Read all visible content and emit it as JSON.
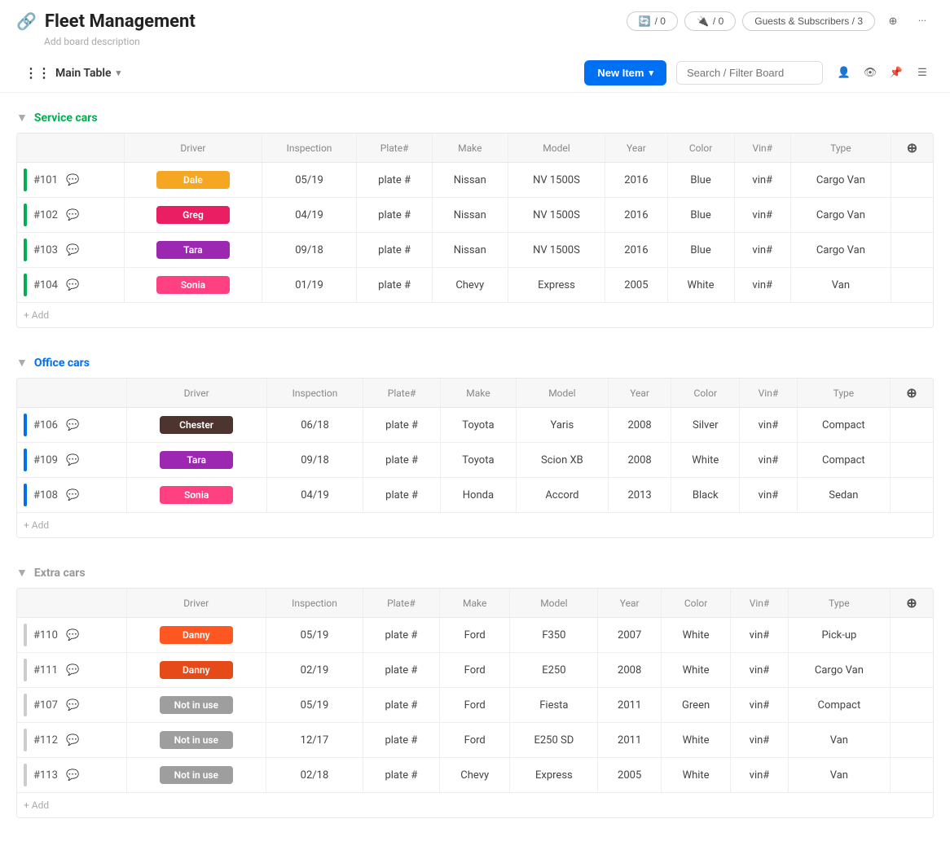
{
  "app": {
    "title": "Fleet Management",
    "subtitle": "Add board description"
  },
  "topbar": {
    "automations_count": "/ 0",
    "integrations_count": "/ 0",
    "guests_label": "Guests & Subscribers / 3",
    "more_icon": "···"
  },
  "toolbar": {
    "main_table_label": "Main Table",
    "new_item_label": "New Item",
    "search_placeholder": "Search / Filter Board"
  },
  "groups": [
    {
      "id": "service",
      "title": "Service cars",
      "color_class": "green",
      "bar_class": "green",
      "columns": [
        "Driver",
        "Inspection",
        "Plate#",
        "Make",
        "Model",
        "Year",
        "Color",
        "Vin#",
        "Type"
      ],
      "rows": [
        {
          "id": "#101",
          "driver": "Dale",
          "driver_color": "#f5a623",
          "inspection": "05/19",
          "plate": "plate #",
          "make": "Nissan",
          "model": "NV 1500S",
          "year": "2016",
          "color": "Blue",
          "vin": "vin#",
          "type": "Cargo Van"
        },
        {
          "id": "#102",
          "driver": "Greg",
          "driver_color": "#e91e63",
          "inspection": "04/19",
          "plate": "plate #",
          "make": "Nissan",
          "model": "NV 1500S",
          "year": "2016",
          "color": "Blue",
          "vin": "vin#",
          "type": "Cargo Van"
        },
        {
          "id": "#103",
          "driver": "Tara",
          "driver_color": "#9c27b0",
          "inspection": "09/18",
          "plate": "plate #",
          "make": "Nissan",
          "model": "NV 1500S",
          "year": "2016",
          "color": "Blue",
          "vin": "vin#",
          "type": "Cargo Van"
        },
        {
          "id": "#104",
          "driver": "Sonia",
          "driver_color": "#ff4081",
          "inspection": "01/19",
          "plate": "plate #",
          "make": "Chevy",
          "model": "Express",
          "year": "2005",
          "color": "White",
          "vin": "vin#",
          "type": "Van"
        }
      ]
    },
    {
      "id": "office",
      "title": "Office cars",
      "color_class": "blue",
      "bar_class": "blue",
      "columns": [
        "Driver",
        "Inspection",
        "Plate#",
        "Make",
        "Model",
        "Year",
        "Color",
        "Vin#",
        "Type"
      ],
      "rows": [
        {
          "id": "#106",
          "driver": "Chester",
          "driver_color": "#4e342e",
          "inspection": "06/18",
          "plate": "plate #",
          "make": "Toyota",
          "model": "Yaris",
          "year": "2008",
          "color": "Silver",
          "vin": "vin#",
          "type": "Compact"
        },
        {
          "id": "#109",
          "driver": "Tara",
          "driver_color": "#9c27b0",
          "inspection": "09/18",
          "plate": "plate #",
          "make": "Toyota",
          "model": "Scion XB",
          "year": "2008",
          "color": "White",
          "vin": "vin#",
          "type": "Compact"
        },
        {
          "id": "#108",
          "driver": "Sonia",
          "driver_color": "#ff4081",
          "inspection": "04/19",
          "plate": "plate #",
          "make": "Honda",
          "model": "Accord",
          "year": "2013",
          "color": "Black",
          "vin": "vin#",
          "type": "Sedan"
        }
      ]
    },
    {
      "id": "extra",
      "title": "Extra cars",
      "color_class": "gray",
      "bar_class": "gray-bar",
      "columns": [
        "Driver",
        "Inspection",
        "Plate#",
        "Make",
        "Model",
        "Year",
        "Color",
        "Vin#",
        "Type"
      ],
      "rows": [
        {
          "id": "#110",
          "driver": "Danny",
          "driver_color": "#ff5722",
          "inspection": "05/19",
          "plate": "plate #",
          "make": "Ford",
          "model": "F350",
          "year": "2007",
          "color": "White",
          "vin": "vin#",
          "type": "Pick-up"
        },
        {
          "id": "#111",
          "driver": "Danny",
          "driver_color": "#e64a19",
          "inspection": "02/19",
          "plate": "plate #",
          "make": "Ford",
          "model": "E250",
          "year": "2008",
          "color": "White",
          "vin": "vin#",
          "type": "Cargo Van"
        },
        {
          "id": "#107",
          "driver": "Not in use",
          "driver_color": "#9e9e9e",
          "inspection": "05/19",
          "plate": "plate #",
          "make": "Ford",
          "model": "Fiesta",
          "year": "2011",
          "color": "Green",
          "vin": "vin#",
          "type": "Compact"
        },
        {
          "id": "#112",
          "driver": "Not in use",
          "driver_color": "#9e9e9e",
          "inspection": "12/17",
          "plate": "plate #",
          "make": "Ford",
          "model": "E250 SD",
          "year": "2011",
          "color": "White",
          "vin": "vin#",
          "type": "Van"
        },
        {
          "id": "#113",
          "driver": "Not in use",
          "driver_color": "#9e9e9e",
          "inspection": "02/18",
          "plate": "plate #",
          "make": "Chevy",
          "model": "Express",
          "year": "2005",
          "color": "White",
          "vin": "vin#",
          "type": "Van"
        }
      ]
    }
  ],
  "add_row_label": "+ Add"
}
